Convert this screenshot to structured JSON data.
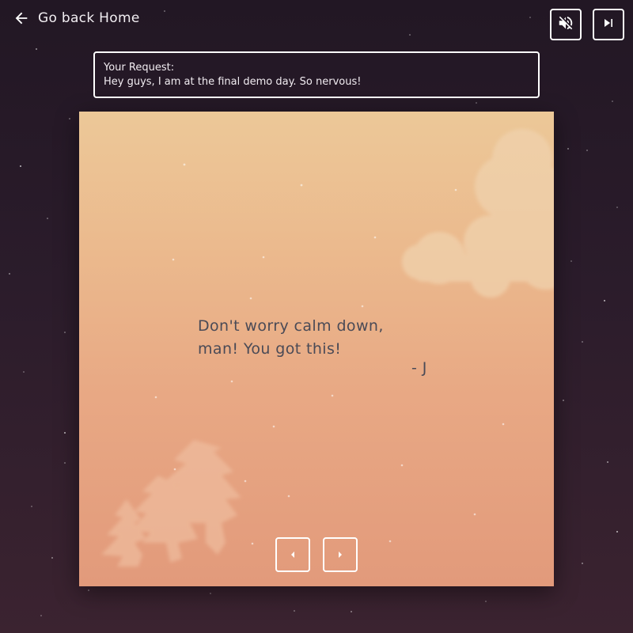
{
  "nav": {
    "back_label": "Go back Home",
    "back_icon": "arrow-left-icon"
  },
  "controls": {
    "mute_icon": "volume-off-icon",
    "skip_icon": "skip-next-icon"
  },
  "request": {
    "heading": "Your Request:",
    "text": "Hey guys, I am at the final demo day. So nervous!"
  },
  "card": {
    "message_line1": "Don't worry calm down,",
    "message_line2": "man! You got this!",
    "signature": "- J",
    "prev_icon": "caret-left-icon",
    "next_icon": "caret-right-icon"
  },
  "colors": {
    "background": "#221724",
    "card_top": "#ecc898",
    "card_bottom": "#e29a7b",
    "text": "#4a4a56",
    "border": "#ffffff"
  }
}
